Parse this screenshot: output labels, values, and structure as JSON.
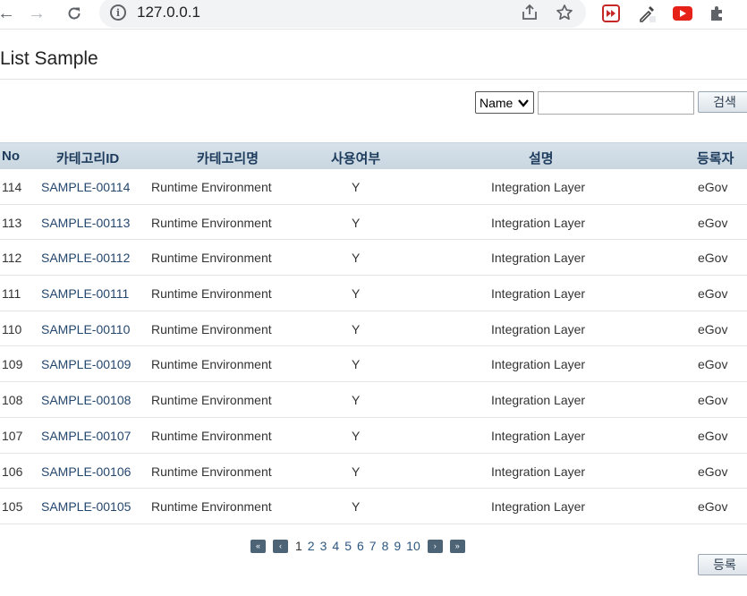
{
  "browser": {
    "url": "127.0.0.1"
  },
  "page": {
    "title": "List Sample"
  },
  "search": {
    "select_value": "Name",
    "input_value": "",
    "button_label": "검색"
  },
  "table": {
    "headers": {
      "no": "No",
      "category_id": "카테고리ID",
      "category_name": "카테고리명",
      "use_yn": "사용여부",
      "description": "설명",
      "registrant": "등록자"
    },
    "rows": [
      {
        "no": "114",
        "category_id": "SAMPLE-00114",
        "category_name": "Runtime Environment",
        "use_yn": "Y",
        "description": "Integration Layer",
        "registrant": "eGov"
      },
      {
        "no": "113",
        "category_id": "SAMPLE-00113",
        "category_name": "Runtime Environment",
        "use_yn": "Y",
        "description": "Integration Layer",
        "registrant": "eGov"
      },
      {
        "no": "112",
        "category_id": "SAMPLE-00112",
        "category_name": "Runtime Environment",
        "use_yn": "Y",
        "description": "Integration Layer",
        "registrant": "eGov"
      },
      {
        "no": "111",
        "category_id": "SAMPLE-00111",
        "category_name": "Runtime Environment",
        "use_yn": "Y",
        "description": "Integration Layer",
        "registrant": "eGov"
      },
      {
        "no": "110",
        "category_id": "SAMPLE-00110",
        "category_name": "Runtime Environment",
        "use_yn": "Y",
        "description": "Integration Layer",
        "registrant": "eGov"
      },
      {
        "no": "109",
        "category_id": "SAMPLE-00109",
        "category_name": "Runtime Environment",
        "use_yn": "Y",
        "description": "Integration Layer",
        "registrant": "eGov"
      },
      {
        "no": "108",
        "category_id": "SAMPLE-00108",
        "category_name": "Runtime Environment",
        "use_yn": "Y",
        "description": "Integration Layer",
        "registrant": "eGov"
      },
      {
        "no": "107",
        "category_id": "SAMPLE-00107",
        "category_name": "Runtime Environment",
        "use_yn": "Y",
        "description": "Integration Layer",
        "registrant": "eGov"
      },
      {
        "no": "106",
        "category_id": "SAMPLE-00106",
        "category_name": "Runtime Environment",
        "use_yn": "Y",
        "description": "Integration Layer",
        "registrant": "eGov"
      },
      {
        "no": "105",
        "category_id": "SAMPLE-00105",
        "category_name": "Runtime Environment",
        "use_yn": "Y",
        "description": "Integration Layer",
        "registrant": "eGov"
      }
    ]
  },
  "pagination": {
    "current": "1",
    "pages": [
      "1",
      "2",
      "3",
      "4",
      "5",
      "6",
      "7",
      "8",
      "9",
      "10"
    ],
    "first_icon": "double-left-arrow-icon",
    "prev_icon": "left-arrow-icon",
    "next_icon": "right-arrow-icon",
    "last_icon": "double-right-arrow-icon"
  },
  "actions": {
    "register_label": "등록"
  },
  "colors": {
    "header_bg": "#d7e2ea",
    "header_text": "#1d3b5c",
    "link": "#24476e",
    "pager_button": "#4d6477"
  }
}
